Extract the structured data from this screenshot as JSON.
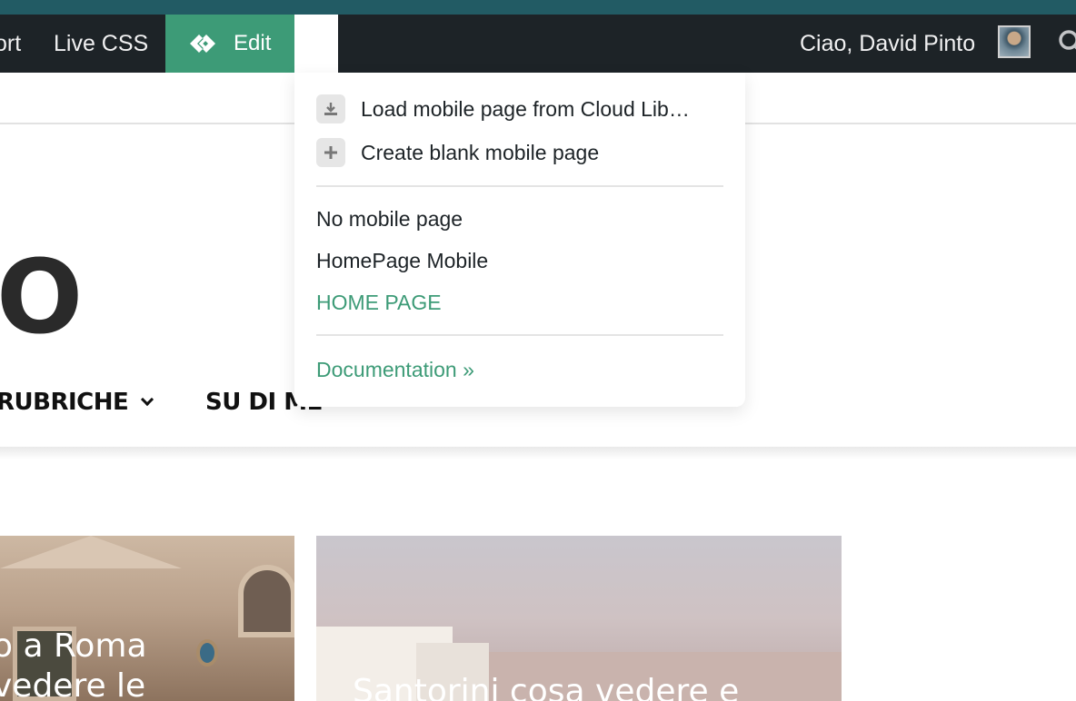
{
  "colors": {
    "top_strip": "#225b64",
    "adminbar": "#1d2327",
    "accent_green": "#3d9b77",
    "dropdown_bg": "#ffffff"
  },
  "adminbar": {
    "items": [
      {
        "label": "ort"
      },
      {
        "label": "Live CSS"
      }
    ],
    "edit": {
      "label": "Edit",
      "icon": "elementor-logo-icon"
    },
    "greeting": "Ciao, David Pinto",
    "avatar_icon": "user-avatar",
    "search_icon": "search-icon"
  },
  "dropdown": {
    "actions": [
      {
        "label": "Load mobile page from Cloud Lib…",
        "icon": "download-icon"
      },
      {
        "label": "Create blank mobile page",
        "icon": "plus-icon"
      }
    ],
    "pages": [
      {
        "label": "No mobile page",
        "selected": false
      },
      {
        "label": "HomePage Mobile",
        "selected": false
      },
      {
        "label": "HOME PAGE",
        "selected": true
      }
    ],
    "documentation": "Documentation »"
  },
  "site": {
    "logo_fragment": "O",
    "nav": [
      {
        "label": "RUBRICHE"
      },
      {
        "label": "SU DI ME"
      }
    ],
    "cards": [
      {
        "title_line1": "o a Roma",
        "title_line2": "vedere le"
      },
      {
        "title_line1": "Santorini cosa vedere e"
      }
    ]
  }
}
